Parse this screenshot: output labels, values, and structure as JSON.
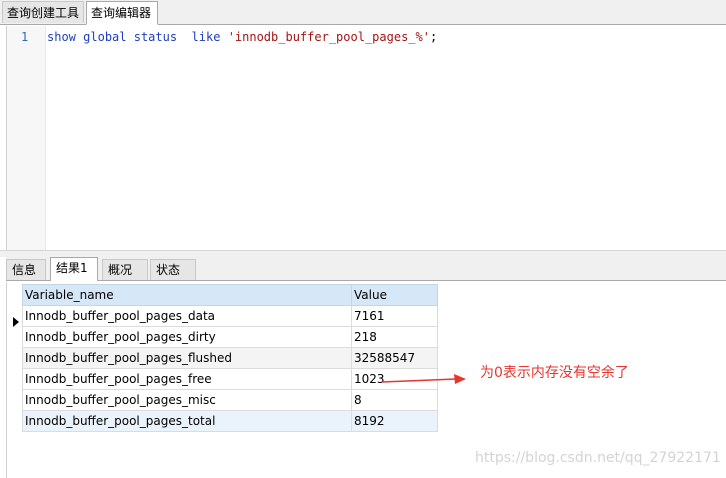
{
  "top_tabs": [
    {
      "label": "查询创建工具"
    },
    {
      "label": "查询编辑器"
    }
  ],
  "editor": {
    "line_number": "1",
    "code_tokens": {
      "kw1": "show",
      "kw2": "global",
      "kw3": "status",
      "kw4": "like",
      "string": "'innodb_buffer_pool_pages_%'",
      "end": ";"
    }
  },
  "bottom_tabs": [
    {
      "label": "信息"
    },
    {
      "label": "结果1"
    },
    {
      "label": "概况"
    },
    {
      "label": "状态"
    }
  ],
  "results": {
    "columns": [
      "Variable_name",
      "Value"
    ],
    "rows": [
      [
        "Innodb_buffer_pool_pages_data",
        "7161"
      ],
      [
        "Innodb_buffer_pool_pages_dirty",
        "218"
      ],
      [
        "Innodb_buffer_pool_pages_flushed",
        "32588547"
      ],
      [
        "Innodb_buffer_pool_pages_free",
        "1023"
      ],
      [
        "Innodb_buffer_pool_pages_misc",
        "8"
      ],
      [
        "Innodb_buffer_pool_pages_total",
        "8192"
      ]
    ]
  },
  "annotation": "为0表示内存没有空余了",
  "watermark": "https://blog.csdn.net/qq_27922171",
  "colors": {
    "annotation": "#e8352e",
    "header": "#d6e8f7"
  }
}
